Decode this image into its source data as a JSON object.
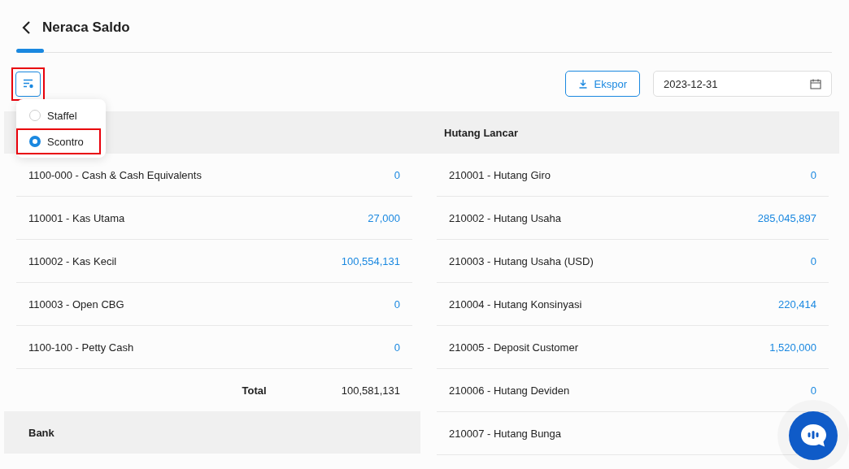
{
  "header": {
    "title": "Neraca Saldo"
  },
  "toolbar": {
    "filter_button": {
      "highlighted": true
    },
    "export_button": "Ekspor",
    "date_field": {
      "value": "2023-12-31"
    }
  },
  "view_menu": {
    "options": [
      {
        "label": "Staffel",
        "selected": false,
        "highlighted": false
      },
      {
        "label": "Scontro",
        "selected": true,
        "highlighted": true
      }
    ]
  },
  "left_column": {
    "sections": [
      {
        "rows": [
          {
            "account": "1100-000 - Cash & Cash Equivalents",
            "amount": "0"
          },
          {
            "account": "110001 - Kas Utama",
            "amount": "27,000"
          },
          {
            "account": "110002 - Kas Kecil",
            "amount": "100,554,131"
          },
          {
            "account": "110003 - Open CBG",
            "amount": "0"
          },
          {
            "account": "1100-100 - Petty Cash",
            "amount": "0"
          }
        ],
        "total_label": "Total",
        "total": "100,581,131"
      },
      {
        "title": "Bank"
      }
    ]
  },
  "right_column": {
    "sections": [
      {
        "title": "Hutang Lancar",
        "rows": [
          {
            "account": "210001 - Hutang Giro",
            "amount": "0"
          },
          {
            "account": "210002 - Hutang Usaha",
            "amount": "285,045,897"
          },
          {
            "account": "210003 - Hutang Usaha (USD)",
            "amount": "0"
          },
          {
            "account": "210004 - Hutang Konsinyasi",
            "amount": "220,414"
          },
          {
            "account": "210005 - Deposit Customer",
            "amount": "1,520,000"
          },
          {
            "account": "210006 - Hutang Deviden",
            "amount": "0"
          },
          {
            "account": "210007 - Hutang Bunga"
          }
        ]
      }
    ]
  }
}
